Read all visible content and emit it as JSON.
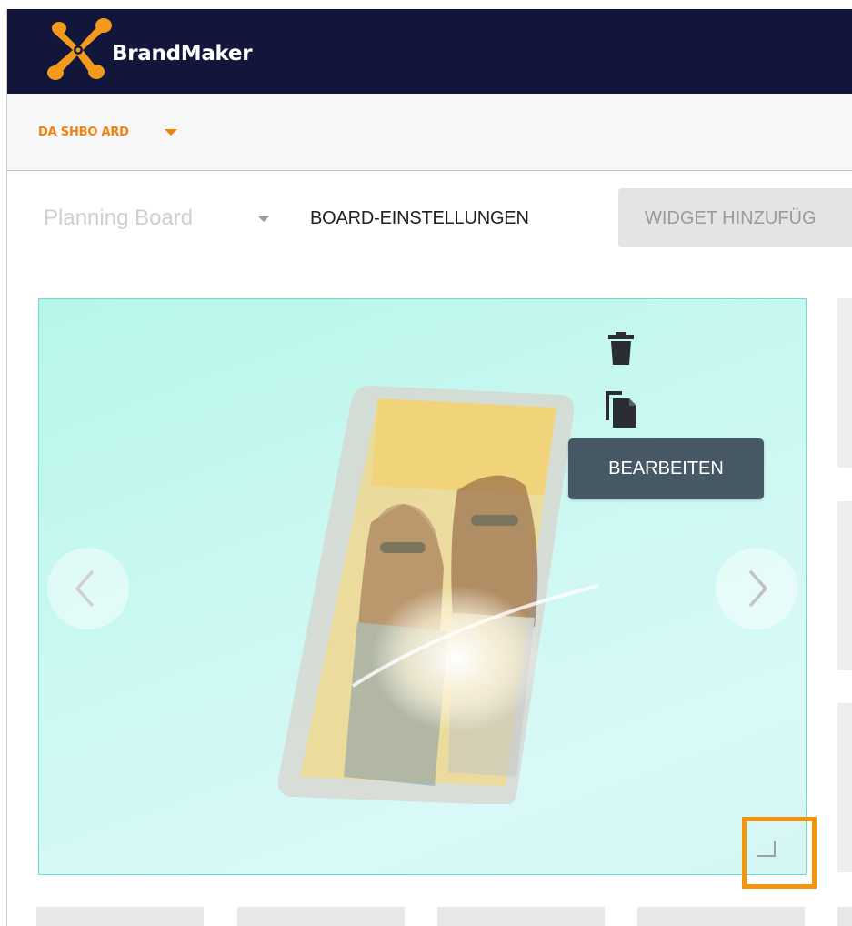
{
  "header": {
    "brand": "BrandMaker",
    "logo_icon": "brandmaker-star-logo",
    "background": "#11163a"
  },
  "subnav": {
    "dashboard_label": "DA SHBO ARD",
    "accent": "#f0820f"
  },
  "toolbar": {
    "board_select_value": "Planning Board",
    "board_settings_label": "BOARD-EINSTELLUNGEN",
    "widget_add_label": "WIDGET HINZUFÜG"
  },
  "carousel": {
    "image_description_icon": "phone-women-image",
    "prev_icon": "chevron-left-icon",
    "next_icon": "chevron-right-icon",
    "border_color": "#63e0d2"
  },
  "widget_actions": {
    "delete_icon": "trash-icon",
    "copy_icon": "copy-icon",
    "edit_tooltip": "BEARBEITEN",
    "resize_icon": "resize-handle-icon",
    "highlight_color": "#f5950c"
  }
}
